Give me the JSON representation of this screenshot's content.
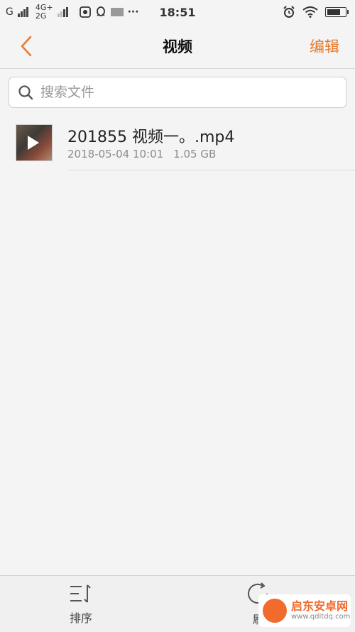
{
  "status_bar": {
    "carrier1": "G",
    "carrier2_top": "4G+",
    "carrier2_bottom": "2G",
    "dots": "···",
    "time": "18:51"
  },
  "header": {
    "title": "视频",
    "edit_label": "编辑"
  },
  "search": {
    "placeholder": "搜索文件"
  },
  "files": [
    {
      "name": "201855 视频一。.mp4",
      "date": "2018-05-04 10:01",
      "size": "1.05 GB"
    }
  ],
  "bottom_bar": {
    "sort_label": "排序",
    "refresh_label": "刷"
  },
  "watermark": {
    "name": "启东安卓网",
    "url": "www.qdltdq.com"
  },
  "colors": {
    "accent": "#e57a2b",
    "background": "#f4f4f4"
  }
}
